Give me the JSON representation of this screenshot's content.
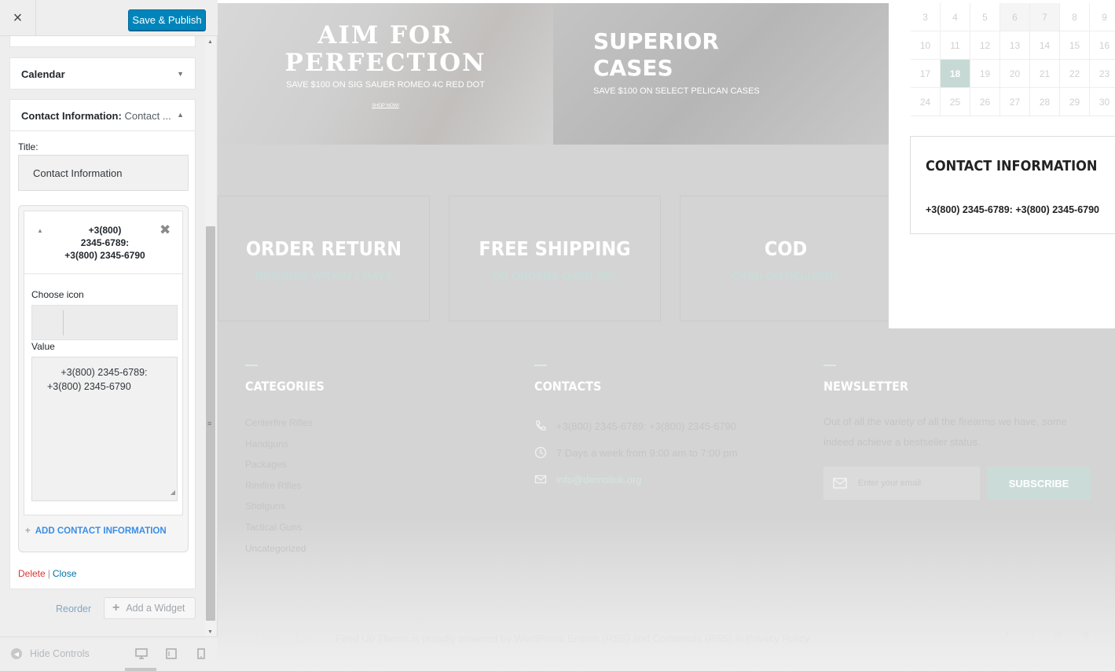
{
  "sidebar": {
    "close_icon": "×",
    "save_label": "Save & Publish",
    "calendar_widget": {
      "title": "Calendar"
    },
    "contact_widget": {
      "title": "Contact Information:",
      "title_sub": "Contact ...",
      "title_label": "Title:",
      "title_value": "Contact Information",
      "item_title": "+3(800)\n2345-6789:\n+3(800) 2345-6790",
      "choose_icon_label": "Choose icon",
      "value_label": "Value",
      "value_text": "     +3(800) 2345-6789:\n+3(800) 2345-6790",
      "add_label": "ADD CONTACT INFORMATION",
      "delete_label": "Delete",
      "separator": "|",
      "close_label": "Close"
    },
    "reorder_label": "Reorder",
    "add_widget_label": "Add a Widget",
    "hide_controls_label": "Hide Controls"
  },
  "preview": {
    "banner1": {
      "headline": "AIM FOR\nPERFECTION",
      "sub": "SAVE $100 ON SIG SAUER ROMEO 4C RED DOT",
      "cta": "SHOP NOW!"
    },
    "banner2": {
      "headline": "SUPERIOR\nCASES",
      "sub": "SAVE $100 ON SELECT PELICAN CASES"
    },
    "features": [
      {
        "title": "ORDER RETURN",
        "sub": "RETURNS WITHIN 7 DAYS"
      },
      {
        "title": "FREE SHIPPING",
        "sub": "ON ORDERS OVER $99."
      },
      {
        "title": "COD",
        "sub": "CASH ON DELIVERY"
      }
    ],
    "calendar": {
      "rows": [
        [
          "3",
          "4",
          "5",
          "6",
          "7",
          "8",
          "9"
        ],
        [
          "10",
          "11",
          "12",
          "13",
          "14",
          "15",
          "16"
        ],
        [
          "17",
          "18",
          "19",
          "20",
          "21",
          "22",
          "23"
        ],
        [
          "24",
          "25",
          "26",
          "27",
          "28",
          "29",
          "30"
        ]
      ],
      "today": "18"
    },
    "contact_widget": {
      "title": "CONTACT INFORMATION",
      "value": "+3(800) 2345-6789: +3(800) 2345-6790"
    },
    "footer": {
      "categories_title": "CATEGORIES",
      "categories": [
        "Centerfire Rifles",
        "Handguns",
        "Packages",
        "Rimfire Rifles",
        "Shotguns",
        "Tactical Guns",
        "Uncategorized"
      ],
      "contacts_title": "CONTACTS",
      "phone": "+3(800) 2345-6789: +3(800) 2345-6790",
      "hours": "7 Days a week from 9:00 am to 7:00 pm",
      "email": "info@demolink.org",
      "newsletter_title": "NEWSLETTER",
      "newsletter_text": "Out of all the variety of all the firearms we have, some indeed achieve a bestseller status.",
      "email_placeholder": "Enter your email",
      "subscribe_label": "SUBSCRIBE",
      "logo": "FIREDUP",
      "copyright": "Fired Up Theme is proudly powered by WordPress Entries (RSS) and Comments (RSS) © Privacy Policy",
      "social_icons": [
        "f",
        "t",
        "in",
        "ig"
      ]
    }
  }
}
